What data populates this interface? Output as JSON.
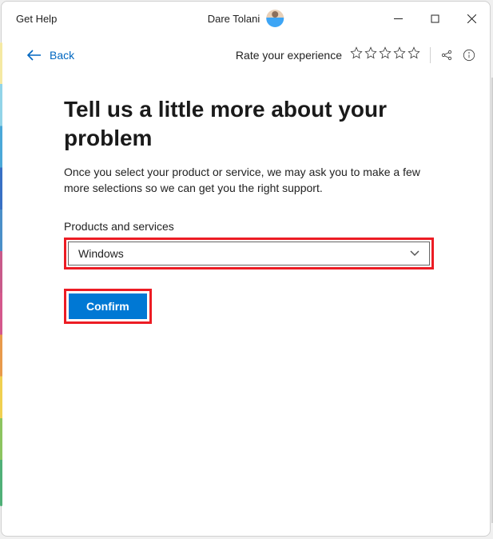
{
  "titlebar": {
    "app_title": "Get Help",
    "user_name": "Dare Tolani"
  },
  "actionbar": {
    "back_label": "Back",
    "rate_label": "Rate your experience"
  },
  "content": {
    "heading": "Tell us a little more about your problem",
    "description": "Once you select your product or service, we may ask you to make a few more selections so we can get you the right support.",
    "field_label": "Products and services",
    "select_value": "Windows",
    "confirm_label": "Confirm"
  },
  "colors": {
    "accent": "#0078d4",
    "link": "#0067c0",
    "highlight": "#ec1c24"
  }
}
